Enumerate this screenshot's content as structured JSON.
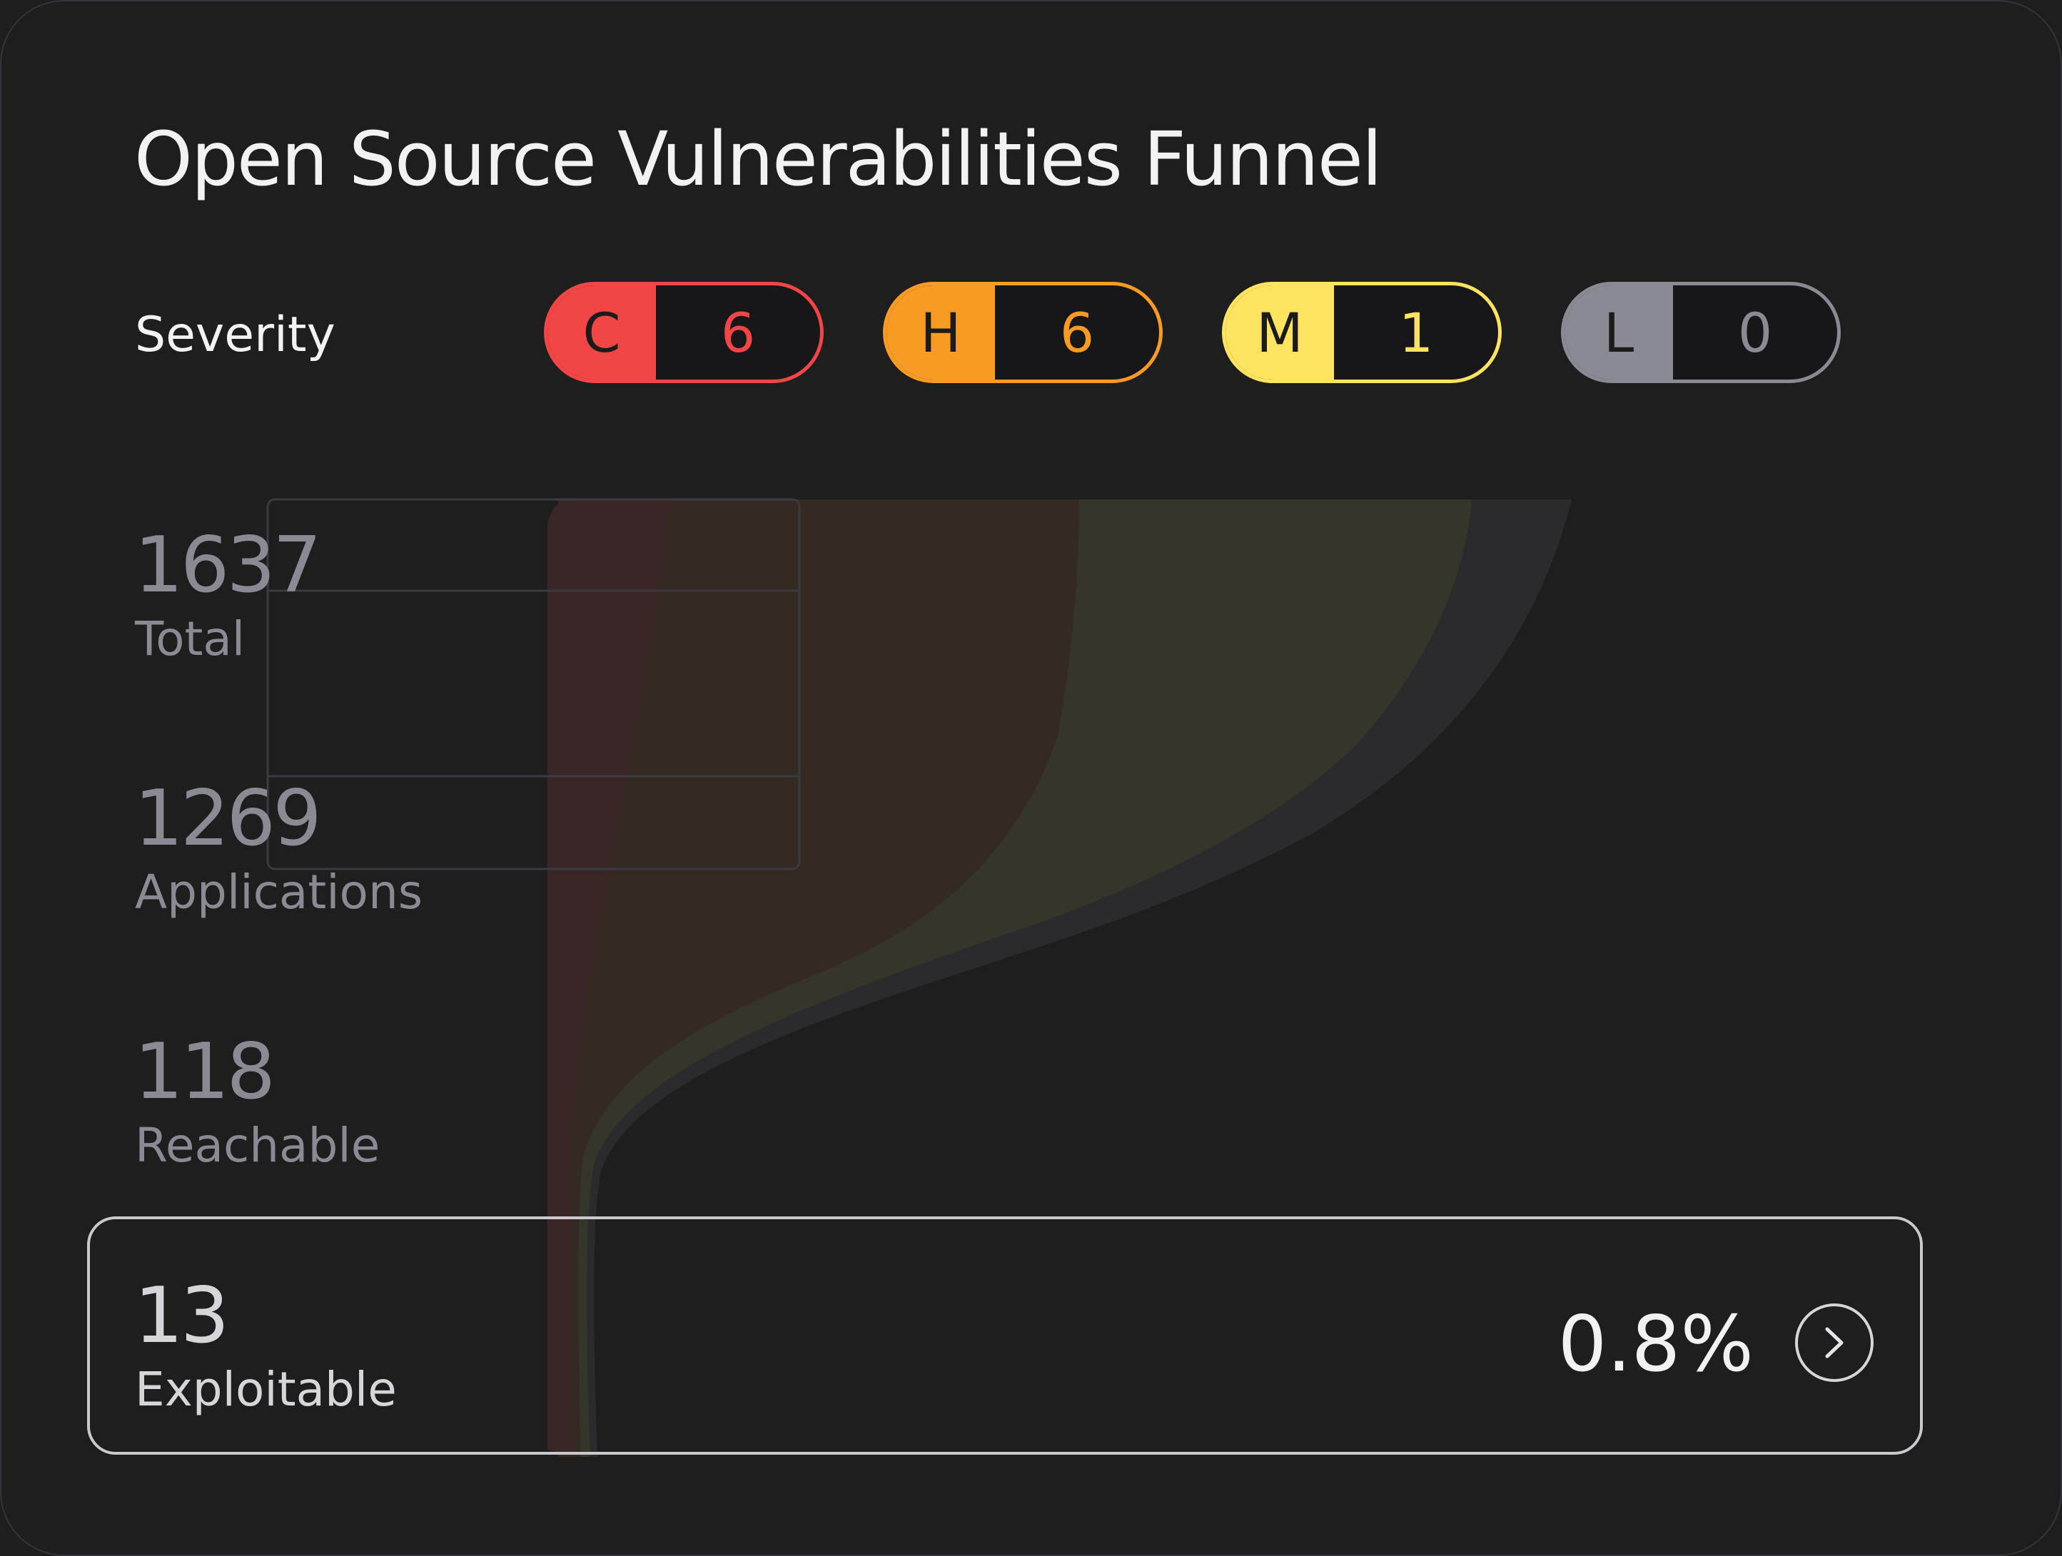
{
  "title": "Open Source Vulnerabilities Funnel",
  "severity": {
    "label": "Severity",
    "pills": [
      {
        "letter": "C",
        "count": "6",
        "color": "#f24646"
      },
      {
        "letter": "H",
        "count": "6",
        "color": "#f89b25"
      },
      {
        "letter": "M",
        "count": "1",
        "color": "#fde35f"
      },
      {
        "letter": "L",
        "count": "0",
        "color": "#8a8a94"
      }
    ]
  },
  "stages": [
    {
      "value": "1637",
      "label": "Total"
    },
    {
      "value": "1269",
      "label": "Applications"
    },
    {
      "value": "118",
      "label": "Reachable"
    },
    {
      "value": "13",
      "label": "Exploitable"
    }
  ],
  "exploitable_percent": "0.8%",
  "icons": {
    "go": "chevron-right-icon"
  }
}
